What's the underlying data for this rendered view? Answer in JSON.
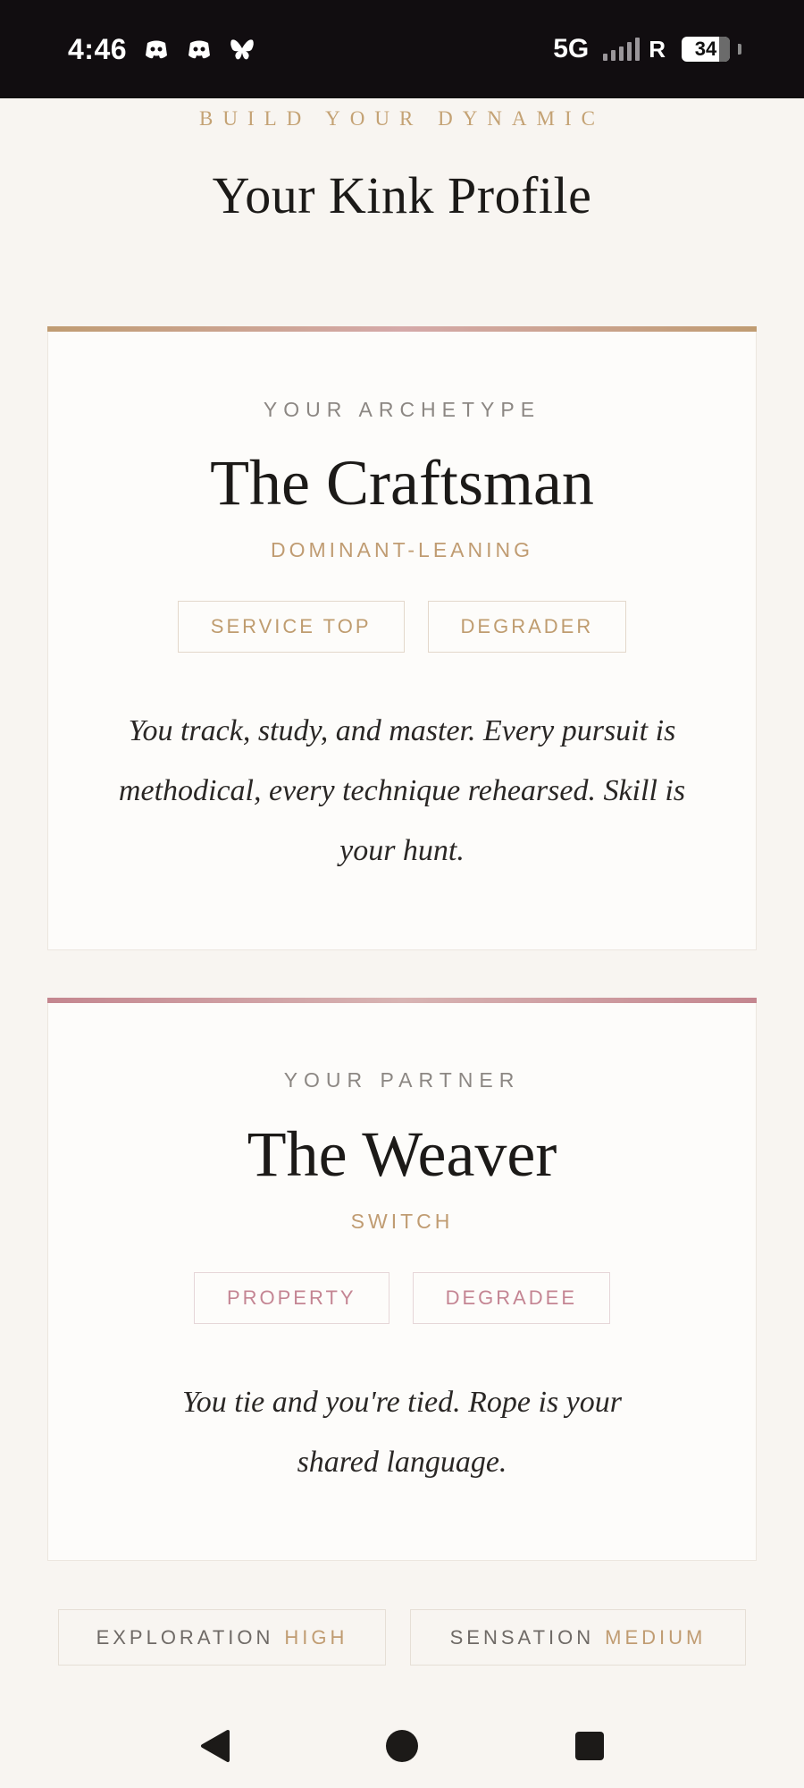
{
  "status_bar": {
    "time": "4:46",
    "network": "5G",
    "roaming": "R",
    "battery": "34",
    "icons": [
      "discord-icon",
      "discord-icon",
      "bluesky-icon"
    ]
  },
  "header": {
    "eyebrow": "BUILD YOUR DYNAMIC",
    "title": "Your Kink Profile"
  },
  "archetype_card": {
    "label": "YOUR ARCHETYPE",
    "name": "The Craftsman",
    "leaning": "DOMINANT-LEANING",
    "tags": [
      "SERVICE TOP",
      "DEGRADER"
    ],
    "description": "You track, study, and master. Every pursuit is methodical, every technique rehearsed. Skill is your hunt."
  },
  "partner_card": {
    "label": "YOUR PARTNER",
    "name": "The Weaver",
    "leaning": "SWITCH",
    "tags": [
      "PROPERTY",
      "DEGRADEE"
    ],
    "description": "You tie and you're tied. Rope is your shared language."
  },
  "stats": {
    "exploration_label": "EXPLORATION",
    "exploration_value": "HIGH",
    "sensation_label": "SENSATION",
    "sensation_value": "MEDIUM"
  },
  "colors": {
    "gold_accent": "#c09c72",
    "rose_accent": "#c48593",
    "background": "#f8f5f1",
    "status_bar": "#110d10"
  }
}
